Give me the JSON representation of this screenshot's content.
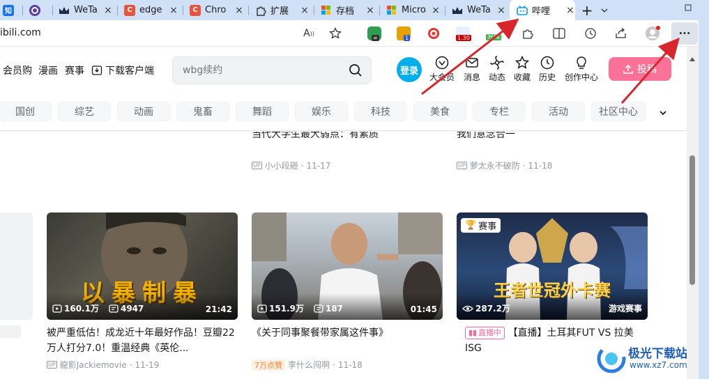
{
  "browser": {
    "tabs": [
      {
        "label": "知",
        "icon": "zhihu-icon",
        "color": "#1772f6"
      },
      {
        "label": "",
        "icon": "circle-target-icon",
        "color": "#5b3aa8"
      },
      {
        "label": "WeTa",
        "icon": "crown-icon",
        "color": "#1e2a4a"
      },
      {
        "label": "edge",
        "icon": "c-logo-icon",
        "color": "#e8533b"
      },
      {
        "label": "Chro",
        "icon": "c-logo-icon",
        "color": "#e8533b"
      },
      {
        "label": "扩展",
        "icon": "puzzle-icon",
        "color": "#333333"
      },
      {
        "label": "存档",
        "icon": "microsoft-logo-icon",
        "color": "#f25022"
      },
      {
        "label": "Micro",
        "icon": "microsoft-logo-icon",
        "color": "#f25022"
      },
      {
        "label": "WeTa",
        "icon": "crown-icon",
        "color": "#1e2a4a"
      },
      {
        "label": "哔哩",
        "icon": "bilibili-tv-icon",
        "color": "#00a1d6"
      }
    ],
    "new_tab_symbol": "+",
    "tab_close_symbol": "×",
    "url": "ibili.com",
    "ext_badges": {
      "ext2": "1",
      "ext4": "1.30",
      "ext5": "完成"
    },
    "more_symbol": "···"
  },
  "site": {
    "nav": [
      "会员购",
      "漫画",
      "赛事",
      "下载客户端"
    ],
    "search_placeholder": "wbg续约",
    "login_label": "登录",
    "header_icons": [
      {
        "label": "大会员",
        "icon": "vip-icon"
      },
      {
        "label": "消息",
        "icon": "message-icon"
      },
      {
        "label": "动态",
        "icon": "dynamic-icon"
      },
      {
        "label": "收藏",
        "icon": "star-icon"
      },
      {
        "label": "历史",
        "icon": "history-icon"
      },
      {
        "label": "创作中心",
        "icon": "bulb-icon"
      }
    ],
    "upload_label": "投稿",
    "categories": [
      "国创",
      "综艺",
      "动画",
      "鬼畜",
      "舞蹈",
      "娱乐",
      "科技",
      "美食",
      "专栏",
      "活动",
      "社区中心"
    ]
  },
  "feed": {
    "top_titles": [
      "当代大学生最大弱点：有素质",
      "我们意念合一"
    ],
    "top_infos": [
      {
        "author": "小小段砸",
        "date": "11-17"
      },
      {
        "author": "萝太永不破防",
        "date": "11-18"
      }
    ],
    "cards": [
      {
        "thumb_text": "以暴制暴",
        "views": "160.1万",
        "danmaku": "4947",
        "duration": "21:42",
        "title": "被严重低估！成龙近十年最好作品！豆瓣22万人打分7.0！重温经典《英伦...",
        "author": "龍影Jackiemovie",
        "date": "11-19"
      },
      {
        "thumb_text": "",
        "views": "151.9万",
        "danmaku": "187",
        "duration": "01:45",
        "title": "《关于同事聚餐带家属这件事》",
        "tag": "7万点赞",
        "author": "李什么闯啊",
        "date": "11-18"
      },
      {
        "badge": "赛事",
        "thumb_text": "王者世冠外卡赛",
        "views": "287.2万",
        "corner_label": "游戏赛事",
        "live_badge": "直播中",
        "title": "【直播】土耳其FUT VS 拉美ISG"
      }
    ]
  },
  "watermark": {
    "text": "极光下载站",
    "url": "www.xz7.com"
  },
  "colors": {
    "tabbar": "#cfe0f7",
    "accent": "#00aeec",
    "pink": "#fb7299",
    "arrow": "#d9262c"
  }
}
